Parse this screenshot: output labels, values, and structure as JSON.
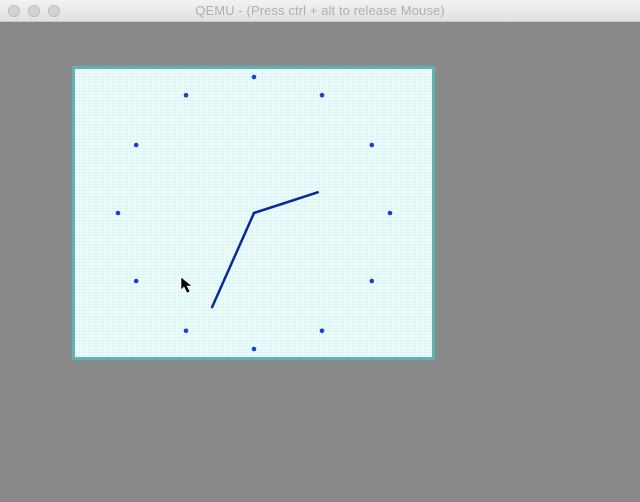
{
  "window": {
    "title": "QEMU - (Press ctrl + alt to release Mouse)"
  },
  "colors": {
    "desktop": "#898989",
    "clock_border": "#5fb3b3",
    "clock_bg": "#e9fbfb",
    "dot": "#1a3fd6",
    "hand": "#0a2a9a"
  },
  "icons": {
    "traffic_close": "close-icon",
    "traffic_min": "minimize-icon",
    "traffic_max": "maximize-icon",
    "cursor": "mouse-pointer-icon"
  },
  "clock": {
    "hour_marks": 12,
    "hour_hand_value": 2.4,
    "minute_hand_value": 34
  }
}
